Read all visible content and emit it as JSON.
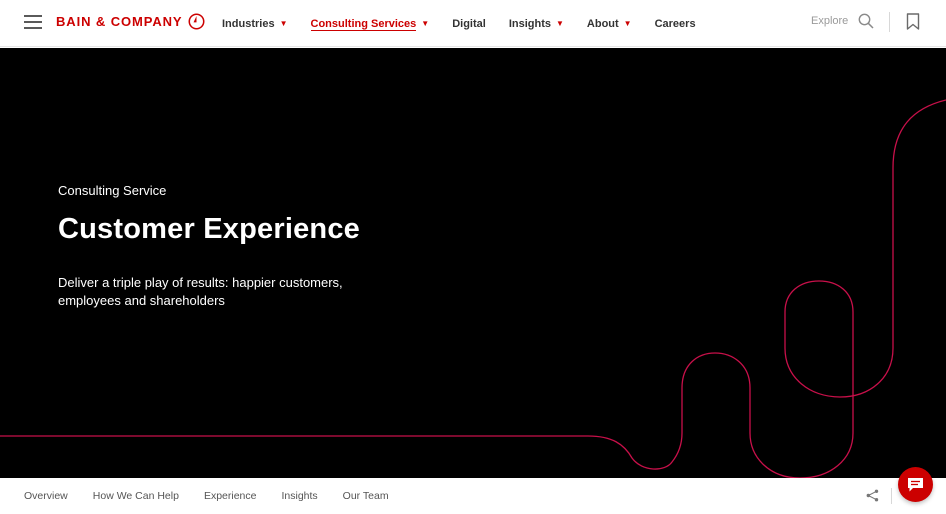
{
  "header": {
    "logo_text": "BAIN & COMPANY",
    "nav": [
      {
        "label": "Industries",
        "has_dropdown": true,
        "active": false
      },
      {
        "label": "Consulting Services",
        "has_dropdown": true,
        "active": true
      },
      {
        "label": "Digital",
        "has_dropdown": false,
        "active": false
      },
      {
        "label": "Insights",
        "has_dropdown": true,
        "active": false
      },
      {
        "label": "About",
        "has_dropdown": true,
        "active": false
      },
      {
        "label": "Careers",
        "has_dropdown": false,
        "active": false
      }
    ],
    "explore_label": "Explore",
    "icons": [
      "menu-icon",
      "search-icon",
      "bookmark-icon"
    ]
  },
  "hero": {
    "eyebrow": "Consulting Service",
    "title": "Customer Experience",
    "description": "Deliver a triple play of results: happier customers, employees and shareholders"
  },
  "subnav": {
    "items": [
      "Overview",
      "How We Can Help",
      "Experience",
      "Insights",
      "Our Team"
    ],
    "icons": [
      "share-icon",
      "chat-icon"
    ]
  },
  "colors": {
    "brand_red": "#cc0000",
    "hero_line": "#c8104a",
    "hero_bg": "#000000"
  }
}
